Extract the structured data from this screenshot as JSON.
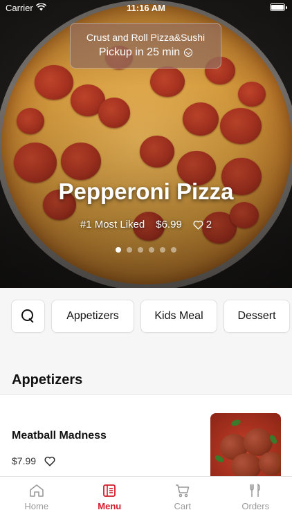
{
  "status_bar": {
    "carrier": "Carrier",
    "time": "11:16 AM"
  },
  "pickup": {
    "store_name": "Crust and Roll Pizza&Sushi",
    "pickup_time": "Pickup in 25 min"
  },
  "featured": {
    "title": "Pepperoni Pizza",
    "rank": "#1 Most Liked",
    "price": "$6.99",
    "likes": "2",
    "carousel_total": 6,
    "carousel_active_index": 0
  },
  "categories": [
    "Appetizers",
    "Kids Meal",
    "Dessert"
  ],
  "section": {
    "title": "Appetizers"
  },
  "menu_items": [
    {
      "name": "Meatball Madness",
      "price": "$7.99"
    }
  ],
  "tab_bar": {
    "tabs": [
      {
        "label": "Home",
        "icon": "home-icon",
        "active": false
      },
      {
        "label": "Menu",
        "icon": "menu-icon",
        "active": true
      },
      {
        "label": "Cart",
        "icon": "cart-icon",
        "active": false
      },
      {
        "label": "Orders",
        "icon": "fork-knife-icon",
        "active": false
      }
    ]
  },
  "colors": {
    "accent": "#d11a2a",
    "inactive_tab": "#9a9a9a",
    "pill_bg": "#966e5a"
  }
}
